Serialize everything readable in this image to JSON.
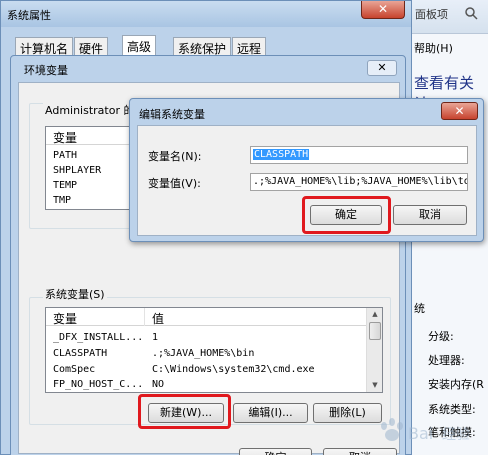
{
  "background_window": {
    "nav_text": "面板项",
    "help_menu": "帮助(H)",
    "heading": "查看有关计",
    "section_title": "统",
    "properties": [
      "分级:",
      "处理器:",
      "安装内存(R",
      "系统类型:",
      "笔和触摸:"
    ]
  },
  "system_properties": {
    "title": "系统属性",
    "close_label": "✕",
    "tabs": [
      "计算机名",
      "硬件",
      "高级",
      "系统保护",
      "远程"
    ],
    "active_tab": "高级"
  },
  "env_dialog": {
    "title": "环境变量",
    "close_label": "✕",
    "user_group_label": "Administrator 的用户变量",
    "user_list": {
      "col_variable": "变量",
      "col_value": "值",
      "rows": [
        {
          "name": "PATH",
          "value": ""
        },
        {
          "name": "SHPLAYER",
          "value": ""
        },
        {
          "name": "TEMP",
          "value": ""
        },
        {
          "name": "TMP",
          "value": ""
        }
      ]
    },
    "system_group_label": "系统变量(S)",
    "system_list": {
      "col_variable": "变量",
      "col_value": "值",
      "rows": [
        {
          "name": "_DFX_INSTALL...",
          "value": "1"
        },
        {
          "name": "CLASSPATH",
          "value": ".;%JAVA_HOME%\\bin"
        },
        {
          "name": "ComSpec",
          "value": "C:\\Windows\\system32\\cmd.exe"
        },
        {
          "name": "FP_NO_HOST_C...",
          "value": "NO"
        }
      ]
    },
    "buttons": {
      "new": "新建(W)...",
      "edit": "编辑(I)...",
      "delete": "删除(L)",
      "ok": "确定",
      "cancel": "取消"
    }
  },
  "edit_dialog": {
    "title": "编辑系统变量",
    "close_label": "✕",
    "name_label": "变量名(N):",
    "name_value": "CLASSPATH",
    "value_label": "变量值(V):",
    "value_value": ".;%JAVA_HOME%\\lib;%JAVA_HOME%\\lib\\to",
    "ok": "确定",
    "cancel": "取消"
  },
  "watermark": "Bai 经验"
}
